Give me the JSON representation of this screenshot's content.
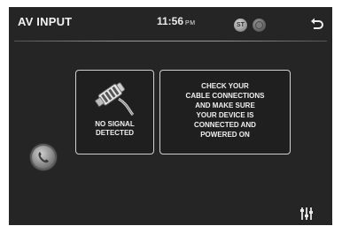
{
  "header": {
    "title": "AV INPUT",
    "time": "11:56",
    "ampm": "PM",
    "st_label": "ST"
  },
  "no_signal": {
    "line1": "NO SIGNAL",
    "line2": "DETECTED"
  },
  "instructions": {
    "lines": [
      "CHECK YOUR",
      "CABLE CONNECTIONS",
      "AND MAKE SURE",
      "YOUR DEVICE IS",
      "CONNECTED AND",
      "POWERED ON"
    ]
  },
  "icons": {
    "back": "back-arrow-icon",
    "phone": "phone-icon",
    "settings": "equalizer-icon",
    "cable": "cable-plug-icon"
  },
  "colors": {
    "screen_bg": "#252525",
    "text": "#f0f0f0",
    "border": "#cfcfcf"
  }
}
